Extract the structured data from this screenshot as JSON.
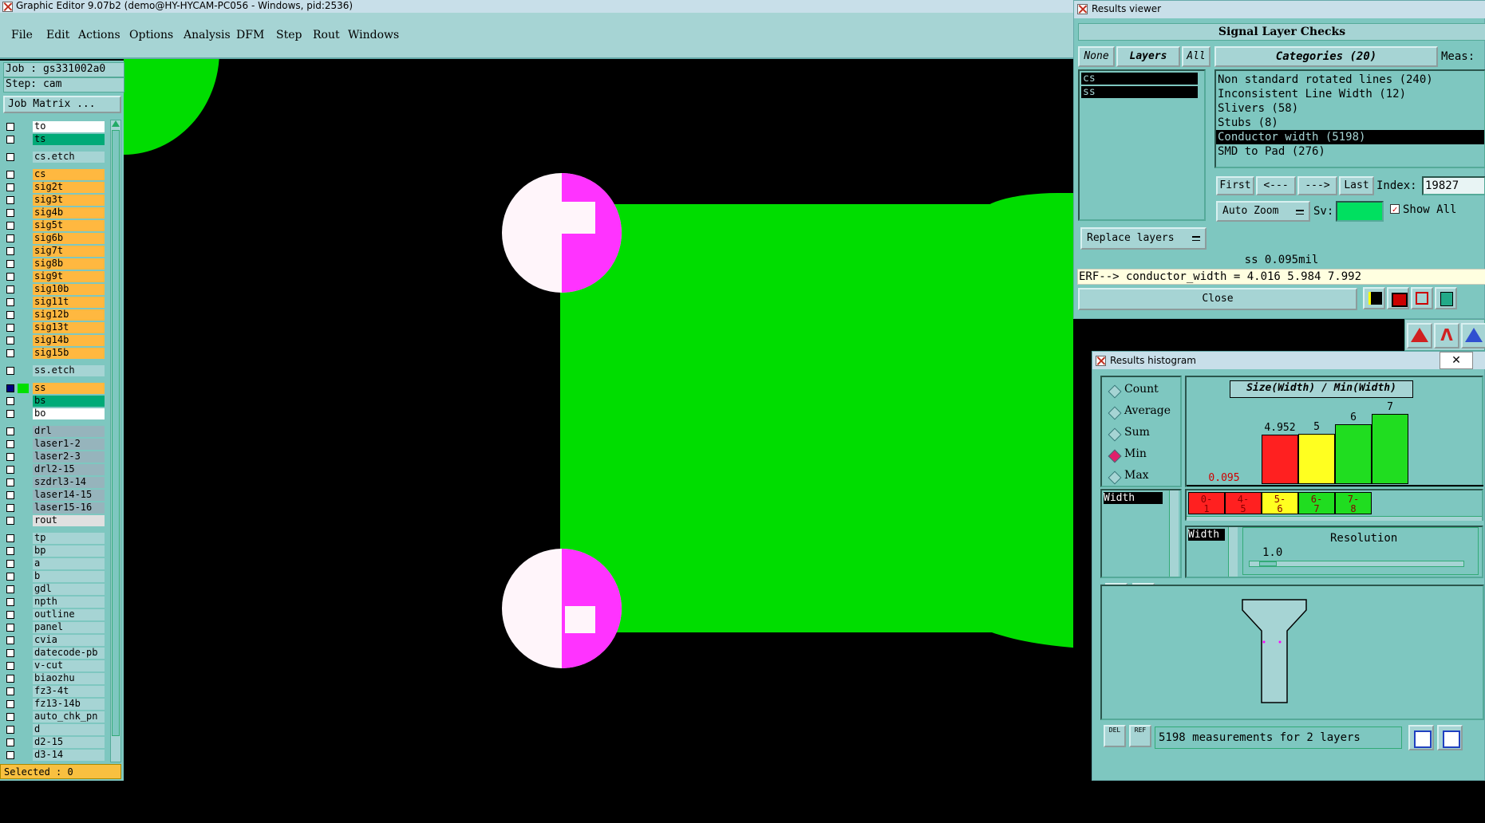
{
  "main": {
    "title": "Graphic Editor 9.07b2 (demo@HY-HYCAM-PC056 - Windows, pid:2536)",
    "menu": [
      "File",
      "Edit",
      "Actions",
      "Options",
      "Analysis",
      "DFM",
      "Step",
      "Rout",
      "Windows"
    ],
    "job_line": "Job : gs331002a0",
    "step_line": "Step: cam",
    "job_matrix_button": "Job Matrix ...",
    "selected": "Selected : 0",
    "colors": {
      "canvas": "#000000",
      "copper": "#00dd00",
      "pad": "#fff5fa",
      "highlight": "#ff33ff"
    }
  },
  "layers": [
    {
      "name": "to",
      "color": "#ffffff",
      "group": 1
    },
    {
      "name": "ts",
      "color": "#00aa77",
      "group": 1
    },
    {
      "name": "cs.etch",
      "color": "#a6d4d4",
      "group": 2
    },
    {
      "name": "cs",
      "color": "#ffb840",
      "group": 3
    },
    {
      "name": "sig2t",
      "color": "#ffb840",
      "group": 3
    },
    {
      "name": "sig3t",
      "color": "#ffb840",
      "group": 3
    },
    {
      "name": "sig4b",
      "color": "#ffb840",
      "group": 3
    },
    {
      "name": "sig5t",
      "color": "#ffb840",
      "group": 3
    },
    {
      "name": "sig6b",
      "color": "#ffb840",
      "group": 3
    },
    {
      "name": "sig7t",
      "color": "#ffb840",
      "group": 3
    },
    {
      "name": "sig8b",
      "color": "#ffb840",
      "group": 3
    },
    {
      "name": "sig9t",
      "color": "#ffb840",
      "group": 3
    },
    {
      "name": "sig10b",
      "color": "#ffb840",
      "group": 3
    },
    {
      "name": "sig11t",
      "color": "#ffb840",
      "group": 3
    },
    {
      "name": "sig12b",
      "color": "#ffb840",
      "group": 3
    },
    {
      "name": "sig13t",
      "color": "#ffb840",
      "group": 3
    },
    {
      "name": "sig14b",
      "color": "#ffb840",
      "group": 3
    },
    {
      "name": "sig15b",
      "color": "#ffb840",
      "group": 3
    },
    {
      "name": "ss.etch",
      "color": "#a6d4d4",
      "group": 4
    },
    {
      "name": "ss",
      "color": "#ffb840",
      "group": 5,
      "active": true
    },
    {
      "name": "bs",
      "color": "#00aa77",
      "group": 5
    },
    {
      "name": "bo",
      "color": "#ffffff",
      "group": 5
    },
    {
      "name": "drl",
      "color": "#96b4bc",
      "group": 6
    },
    {
      "name": "laser1-2",
      "color": "#96b4bc",
      "group": 6
    },
    {
      "name": "laser2-3",
      "color": "#96b4bc",
      "group": 6
    },
    {
      "name": "drl2-15",
      "color": "#96b4bc",
      "group": 6
    },
    {
      "name": "szdrl3-14",
      "color": "#96b4bc",
      "group": 6
    },
    {
      "name": "laser14-15",
      "color": "#96b4bc",
      "group": 6
    },
    {
      "name": "laser15-16",
      "color": "#96b4bc",
      "group": 6
    },
    {
      "name": "rout",
      "color": "#e0e0e0",
      "group": 6
    },
    {
      "name": "tp",
      "color": "#a6d4d4",
      "group": 7
    },
    {
      "name": "bp",
      "color": "#a6d4d4",
      "group": 7
    },
    {
      "name": "a",
      "color": "#a6d4d4",
      "group": 7
    },
    {
      "name": "b",
      "color": "#a6d4d4",
      "group": 7
    },
    {
      "name": "gdl",
      "color": "#a6d4d4",
      "group": 7
    },
    {
      "name": "npth",
      "color": "#a6d4d4",
      "group": 7
    },
    {
      "name": "outline",
      "color": "#a6d4d4",
      "group": 7
    },
    {
      "name": "panel",
      "color": "#a6d4d4",
      "group": 7
    },
    {
      "name": "cvia",
      "color": "#a6d4d4",
      "group": 7
    },
    {
      "name": "datecode-pb",
      "color": "#a6d4d4",
      "group": 7
    },
    {
      "name": "v-cut",
      "color": "#a6d4d4",
      "group": 7
    },
    {
      "name": "biaozhu",
      "color": "#a6d4d4",
      "group": 7
    },
    {
      "name": "fz3-4t",
      "color": "#a6d4d4",
      "group": 7
    },
    {
      "name": "fz13-14b",
      "color": "#a6d4d4",
      "group": 7
    },
    {
      "name": "auto_chk_pn",
      "color": "#a6d4d4",
      "group": 7
    },
    {
      "name": "d",
      "color": "#a6d4d4",
      "group": 7
    },
    {
      "name": "d2-15",
      "color": "#a6d4d4",
      "group": 7
    },
    {
      "name": "d3-14",
      "color": "#a6d4d4",
      "group": 7
    }
  ],
  "results_viewer": {
    "title": "Results viewer",
    "header": "Signal Layer Checks",
    "none_button": "None",
    "layers_button": "Layers",
    "all_button": "All",
    "categories_header": "Categories (20)",
    "meas_label": "Meas:",
    "layer_items": [
      "cs",
      "ss"
    ],
    "categories": [
      "Non standard rotated lines (240)",
      "Inconsistent Line Width (12)",
      "Slivers (58)",
      "Stubs (8)",
      "Conductor width (5198)",
      "SMD to Pad (276)"
    ],
    "selected_category": 4,
    "first_button": "First",
    "prev_button": "<---",
    "next_button": "--->",
    "last_button": "Last",
    "index_label": "Index:",
    "index_value": "19827",
    "auto_zoom": "Auto Zoom",
    "sv_label": "Sv:",
    "show_all": "Show All",
    "replace_layers": "Replace layers",
    "status_line": "ss 0.095mil",
    "erf_line": "ERF--> conductor_width = 4.016 5.984 7.992",
    "close_button": "Close"
  },
  "histogram": {
    "title": "Results histogram",
    "modes": [
      "Count",
      "Average",
      "Sum",
      "Min",
      "Max"
    ],
    "selected_mode": 3,
    "list_item": "Width",
    "chart_title": "Size(Width) / Min(Width)",
    "bins_label": "Width",
    "resolution_label": "Resolution",
    "resolution_value": "1.0",
    "footer_text": "5198 measurements for 2 layers",
    "del_label": "DEL",
    "ref_label": "REF"
  },
  "chart_data": {
    "type": "bar",
    "title": "Size(Width) / Min(Width)",
    "categories": [
      "0-1",
      "4-5",
      "5-6",
      "6-7",
      "7-8"
    ],
    "category_labels_top": [
      "0-",
      "4-",
      "5-",
      "6-",
      "7-"
    ],
    "category_labels_bottom": [
      "1",
      "5",
      "6",
      "7",
      "8"
    ],
    "values": [
      0.095,
      4.952,
      5,
      6,
      7
    ],
    "value_labels": [
      "0.095",
      "4.952",
      "5",
      "6",
      "7"
    ],
    "colors": [
      "#ff2020",
      "#ff2020",
      "#ffff20",
      "#20dd20",
      "#20dd20"
    ],
    "ylim": [
      0,
      7.6
    ]
  }
}
